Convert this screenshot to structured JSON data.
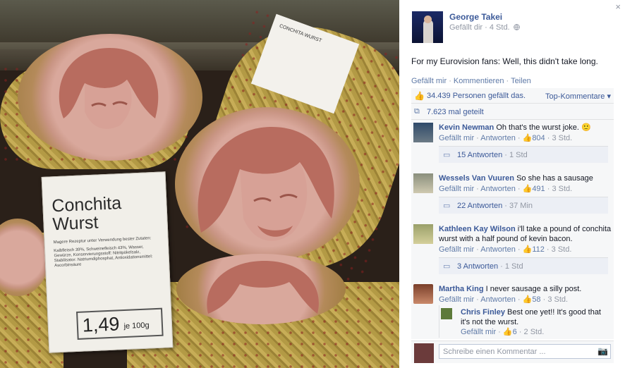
{
  "photo": {
    "card_title_line1": "Conchita",
    "card_title_line2": "Wurst",
    "card_subtitle": "Magere Rezeptur unter Verwendung bester Zutaten:",
    "card_ingredients": "Kalbfleisch 39%, Schweinefleisch 43%, Wasser, Gewürze, Konservierungsstoff: Nitritpökelsalz, Stabilisator: Natriumdiphosphat, Antioxidationsmittel: Ascorbinsäure",
    "card_price": "1,49",
    "card_unit": "je 100g",
    "sticker_text": "CONCHITA WURST"
  },
  "post": {
    "close_icon": "×",
    "author": "George Takei",
    "meta_action": "Gefällt dir",
    "meta_time": "4 Std.",
    "globe_icon": "globe-icon",
    "text": "For my Eurovision fans: Well, this didn't take long.",
    "actions": [
      "Gefällt mir",
      "Kommentieren",
      "Teilen"
    ],
    "likes_text": "34.439 Personen gefällt das.",
    "top_comments": "Top-Kommentare",
    "shares_text": "7.623 mal geteilt"
  },
  "comments": [
    {
      "name": "Kevin Newman",
      "text": "Oh that's the wurst joke. 🙂",
      "like": "Gefällt mir",
      "reply": "Antworten",
      "likes": "804",
      "time": "3 Std.",
      "replies": "15 Antworten",
      "replies_time": "1 Std"
    },
    {
      "name": "Wessels Van Vuuren",
      "text": "So she has a sausage",
      "like": "Gefällt mir",
      "reply": "Antworten",
      "likes": "491",
      "time": "3 Std.",
      "replies": "22 Antworten",
      "replies_time": "37 Min"
    },
    {
      "name": "Kathleen Kay Wilson",
      "text": "i'll take a pound of conchita wurst with a half pound of kevin bacon.",
      "like": "Gefällt mir",
      "reply": "Antworten",
      "likes": "112",
      "time": "3 Std.",
      "replies": "3 Antworten",
      "replies_time": "1 Std"
    },
    {
      "name": "Martha King",
      "text": "I never sausage a silly post.",
      "like": "Gefällt mir",
      "reply": "Antworten",
      "likes": "58",
      "time": "3 Std."
    }
  ],
  "nested_reply": {
    "name": "Chris Finley",
    "text": "Best one yet!! It's good that it's not the wurst.",
    "like": "Gefällt mir",
    "likes": "6",
    "time": "2 Std."
  },
  "composer": {
    "placeholder": "Schreibe einen Kommentar ..."
  }
}
